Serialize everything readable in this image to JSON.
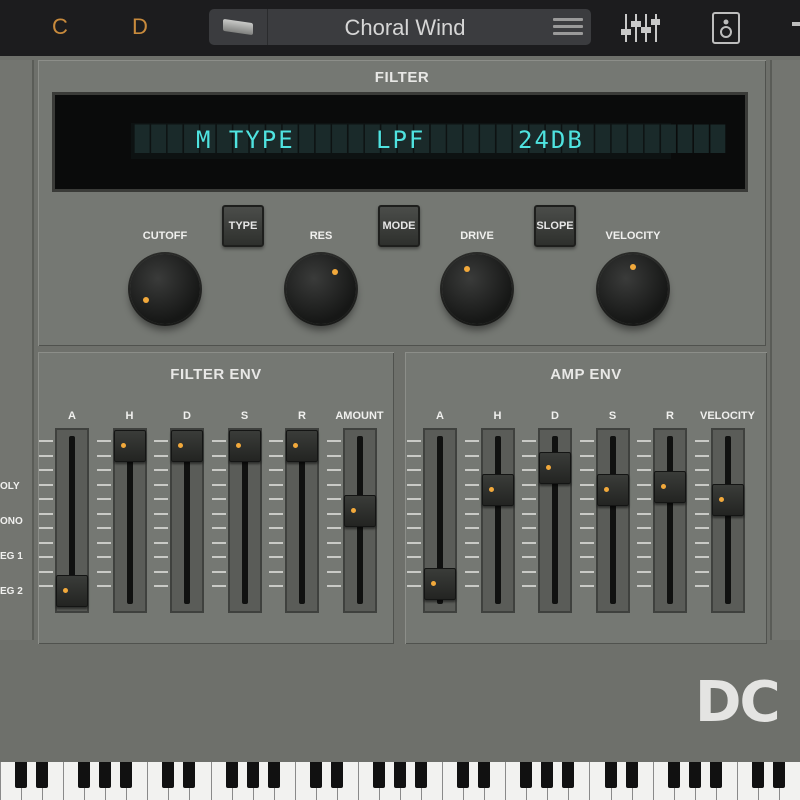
{
  "topbar": {
    "note_1": "C",
    "note_2": "D",
    "preset_name": "Choral Wind",
    "icons": [
      "keyboard-thumb-icon",
      "hamburger-menu-icon",
      "mixer-icon",
      "speaker-icon",
      "more-icon"
    ]
  },
  "filter": {
    "title": "FILTER",
    "lcd": {
      "param": "M TYPE",
      "value": "LPF",
      "extra": "24DB"
    },
    "buttons": [
      {
        "label": "TYPE"
      },
      {
        "label": "MODE"
      },
      {
        "label": "SLOPE"
      }
    ],
    "knobs": [
      {
        "label": "CUTOFF",
        "value": 0.05
      },
      {
        "label": "RES",
        "value": 0.65
      },
      {
        "label": "DRIVE",
        "value": 0.4
      },
      {
        "label": "VELOCITY",
        "value": 0.5
      }
    ]
  },
  "filter_env": {
    "title": "FILTER ENV",
    "faders": [
      {
        "label": "A",
        "value": 0.0
      },
      {
        "label": "H",
        "value": 1.0
      },
      {
        "label": "D",
        "value": 1.0
      },
      {
        "label": "S",
        "value": 1.0
      },
      {
        "label": "R",
        "value": 1.0
      },
      {
        "label": "AMOUNT",
        "value": 0.55
      }
    ]
  },
  "amp_env": {
    "title": "AMP ENV",
    "faders": [
      {
        "label": "A",
        "value": 0.05
      },
      {
        "label": "H",
        "value": 0.7
      },
      {
        "label": "D",
        "value": 0.85
      },
      {
        "label": "S",
        "value": 0.7
      },
      {
        "label": "R",
        "value": 0.72
      },
      {
        "label": "VELOCITY",
        "value": 0.63
      }
    ]
  },
  "side_labels": [
    "OLY",
    "ONO",
    "EG 1",
    "EG 2"
  ],
  "logo_text": "DC",
  "colors": {
    "accent": "#f2a93b",
    "lcd": "#4fe3e0",
    "panel": "#757873"
  }
}
